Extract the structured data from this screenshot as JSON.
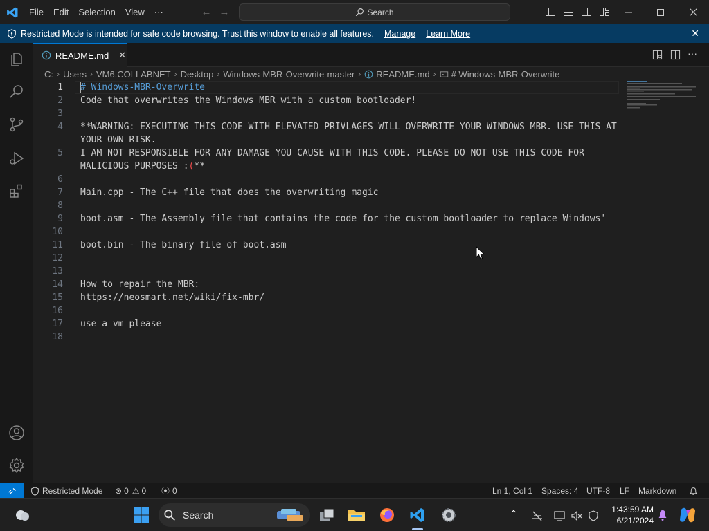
{
  "menu": [
    "File",
    "Edit",
    "Selection",
    "View",
    "···"
  ],
  "search_label": "Search",
  "banner": {
    "message": "Restricted Mode is intended for safe code browsing. Trust this window to enable all features.",
    "manage": "Manage",
    "learn_more": "Learn More"
  },
  "tab": {
    "name": "README.md"
  },
  "breadcrumb": [
    "C:",
    "Users",
    "VM6.COLLABNET",
    "Desktop",
    "Windows-MBR-Overwrite-master",
    "README.md",
    "# Windows-MBR-Overwrite"
  ],
  "editor": {
    "line_numbers": [
      "1",
      "2",
      "3",
      "4",
      "",
      "5",
      "",
      "6",
      "7",
      "8",
      "9",
      "10",
      "11",
      "12",
      "13",
      "14",
      "15",
      "16",
      "17",
      "18"
    ],
    "lines": [
      "# Windows-MBR-Overwrite",
      "Code that overwrites the Windows MBR with a custom bootloader!",
      "",
      "**WARNING: EXECUTING THIS CODE WITH ELEVATED PRIVLAGES WILL OVERWRITE YOUR WINDOWS MBR. USE THIS AT",
      "YOUR OWN RISK.",
      "I AM NOT RESPONSIBLE FOR ANY DAMAGE YOU CAUSE WITH THIS CODE. PLEASE DO NOT USE THIS CODE FOR",
      "MALICIOUS PURPOSES :",
      "",
      "Main.cpp - The C++ file that does the overwriting magic",
      "",
      "boot.asm - The Assembly file that contains the code for the custom bootloader to replace Windows'",
      "",
      "boot.bin - The binary file of boot.asm",
      "",
      "",
      "How to repair the MBR:",
      "https://neosmart.net/wiki/fix-mbr/",
      "",
      "use a vm please",
      ""
    ],
    "line6_paren": "(",
    "line6_tail": "**"
  },
  "status": {
    "restricted": "Restricted Mode",
    "errors": "0",
    "warnings": "0",
    "ports": "0",
    "position": "Ln 1, Col 1",
    "spaces": "Spaces: 4",
    "encoding": "UTF-8",
    "eol": "LF",
    "language": "Markdown"
  },
  "taskbar": {
    "search": "Search",
    "time": "1:43:59 AM",
    "date": "6/21/2024"
  },
  "colors": {
    "accent": "#0078d4",
    "banner": "#063b62",
    "heading": "#569cd6",
    "error_paren": "#f14c4c"
  }
}
